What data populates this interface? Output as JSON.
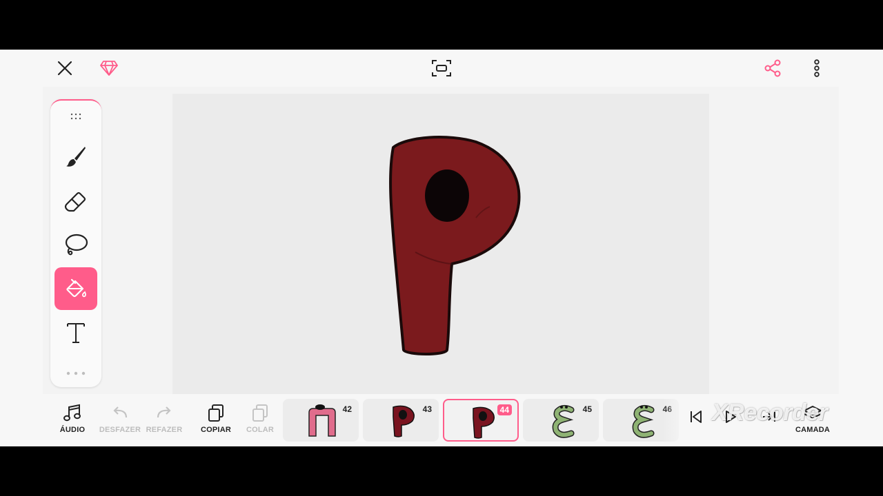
{
  "toolbar": {
    "close_icon": "close-icon",
    "premium_icon": "diamond-icon",
    "fit_icon": "fit-screen-icon",
    "share_icon": "share-icon",
    "more_icon": "more-vertical-icon",
    "accent": "#ff5c8a"
  },
  "tools": [
    {
      "name": "drag-handle",
      "icon": "grip-dots-icon"
    },
    {
      "name": "brush",
      "icon": "brush-icon"
    },
    {
      "name": "eraser",
      "icon": "eraser-icon"
    },
    {
      "name": "lasso",
      "icon": "lasso-icon"
    },
    {
      "name": "fill",
      "icon": "paint-bucket-icon",
      "active": true
    },
    {
      "name": "text",
      "icon": "text-icon"
    }
  ],
  "bottom": {
    "audio_label": "ÁUDIO",
    "undo_label": "DESFAZER",
    "redo_label": "REFAZER",
    "copy_label": "COPIAR",
    "paste_label": "COLAR",
    "layer_label": "CAMADA"
  },
  "frames": [
    {
      "number": "42",
      "color": "#e06c8c"
    },
    {
      "number": "43",
      "color": "#7a1420"
    },
    {
      "number": "44",
      "color": "#7a1420",
      "active": true
    },
    {
      "number": "45",
      "color": "#8fb374"
    },
    {
      "number": "46",
      "color": "#8fb374"
    }
  ],
  "watermark": "XRecorder",
  "drawing": {
    "letter_color": "#7b1a1d",
    "outline_color": "#1a0a0a"
  }
}
